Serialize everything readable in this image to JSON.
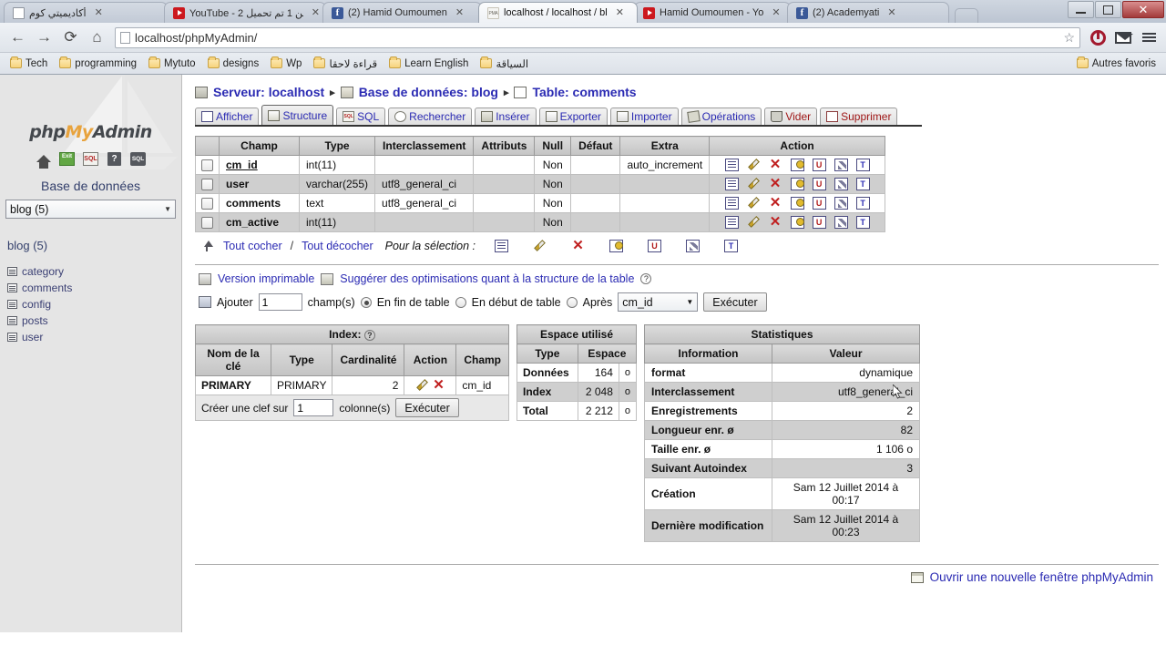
{
  "browser": {
    "tabs": [
      {
        "title": "أكاديميتي كوم",
        "favicon": "document-icon",
        "active": false,
        "width": 180
      },
      {
        "title": "YouTube - 2 من 1 تم تحميل",
        "favicon": "youtube-icon",
        "active": false,
        "width": 178
      },
      {
        "title": "(2) Hamid Oumoumen",
        "favicon": "facebook-icon",
        "active": false,
        "width": 175
      },
      {
        "title": "localhost / localhost / bl",
        "favicon": "phpmyadmin-icon",
        "active": true,
        "width": 175
      },
      {
        "title": "Hamid Oumoumen - Yo",
        "favicon": "youtube-icon",
        "active": false,
        "width": 172
      },
      {
        "title": "(2) Academyati",
        "favicon": "facebook-icon",
        "active": false,
        "width": 178
      }
    ],
    "tab_close_glyph": "✕",
    "nav": {
      "back": "←",
      "forward": "→",
      "reload": "⟳",
      "home": "⌂"
    },
    "url": "localhost/phpMyAdmin/",
    "url_host": "localhost",
    "url_path": "/phpMyAdmin/",
    "star_glyph": "☆",
    "window_controls": {
      "minimize": "",
      "maximize": "",
      "close": "✕"
    },
    "bookmarks": [
      "Tech",
      "programming",
      "Mytuto",
      "designs",
      "Wp",
      "قراءة لاحقا",
      "Learn English",
      "السياقة"
    ],
    "other_bookmarks": "Autres favoris"
  },
  "sidebar": {
    "logo": {
      "php": "php",
      "my": "My",
      "admin": "Admin"
    },
    "icons": [
      {
        "name": "home-icon",
        "label": ""
      },
      {
        "name": "exit-icon",
        "label": "Exit"
      },
      {
        "name": "sql-icon",
        "label": "SQL"
      },
      {
        "name": "help-icon",
        "label": "?"
      },
      {
        "name": "sql-bubble-icon",
        "label": "SQL"
      }
    ],
    "db_label": "Base de données",
    "db_select_value": "blog (5)",
    "db_current": "blog (5)",
    "tables": [
      "category",
      "comments",
      "config",
      "posts",
      "user"
    ]
  },
  "breadcrumb": {
    "server_label": "Serveur: localhost",
    "db_label": "Base de données: blog",
    "table_label": "Table: comments",
    "separator": "▸"
  },
  "tabs": [
    {
      "label": "Afficher",
      "icon": "view-icon",
      "active": false,
      "danger": false
    },
    {
      "label": "Structure",
      "icon": "structure-icon",
      "active": true,
      "danger": false
    },
    {
      "label": "SQL",
      "icon": "sql-icon",
      "active": false,
      "danger": false
    },
    {
      "label": "Rechercher",
      "icon": "search-icon",
      "active": false,
      "danger": false
    },
    {
      "label": "Insérer",
      "icon": "insert-icon",
      "active": false,
      "danger": false
    },
    {
      "label": "Exporter",
      "icon": "export-icon",
      "active": false,
      "danger": false
    },
    {
      "label": "Importer",
      "icon": "import-icon",
      "active": false,
      "danger": false
    },
    {
      "label": "Opérations",
      "icon": "operations-icon",
      "active": false,
      "danger": false
    },
    {
      "label": "Vider",
      "icon": "empty-icon",
      "active": false,
      "danger": true
    },
    {
      "label": "Supprimer",
      "icon": "drop-icon",
      "active": false,
      "danger": true
    }
  ],
  "structure": {
    "headers": [
      "",
      "Champ",
      "Type",
      "Interclassement",
      "Attributs",
      "Null",
      "Défaut",
      "Extra",
      "Action"
    ],
    "rows": [
      {
        "champ": "cm_id",
        "primary": true,
        "type": "int(11)",
        "interclassement": "",
        "attributs": "",
        "null": "Non",
        "defaut": "",
        "extra": "auto_increment"
      },
      {
        "champ": "user",
        "primary": false,
        "type": "varchar(255)",
        "interclassement": "utf8_general_ci",
        "attributs": "",
        "null": "Non",
        "defaut": "",
        "extra": ""
      },
      {
        "champ": "comments",
        "primary": false,
        "type": "text",
        "interclassement": "utf8_general_ci",
        "attributs": "",
        "null": "Non",
        "defaut": "",
        "extra": ""
      },
      {
        "champ": "cm_active",
        "primary": false,
        "type": "int(11)",
        "interclassement": "",
        "attributs": "",
        "null": "Non",
        "defaut": "",
        "extra": ""
      }
    ],
    "action_icons": [
      "browse-icon",
      "edit-icon",
      "delete-icon",
      "primary-key-icon",
      "unique-icon",
      "index-icon",
      "fulltext-icon"
    ]
  },
  "selection_bar": {
    "check_all": "Tout cocher",
    "separator": "/",
    "uncheck_all": "Tout décocher",
    "for_selection": "Pour la sélection :",
    "icons": [
      "browse-icon",
      "edit-icon",
      "delete-icon",
      "primary-key-icon",
      "unique-icon",
      "index-icon",
      "fulltext-icon"
    ]
  },
  "links": {
    "printable": "Version imprimable",
    "optimize": "Suggérer des optimisations quant à la structure de la table",
    "help_glyph": "?"
  },
  "add_field": {
    "label": "Ajouter",
    "count": "1",
    "unit": "champ(s)",
    "option_end": "En fin de table",
    "option_begin": "En début de table",
    "option_after": "Après",
    "after_value": "cm_id",
    "selected_option": "end",
    "execute": "Exécuter"
  },
  "index_panel": {
    "title": "Index:",
    "help_glyph": "?",
    "headers": [
      "Nom de la clé",
      "Type",
      "Cardinalité",
      "Action",
      "Champ"
    ],
    "rows": [
      {
        "nom": "PRIMARY",
        "type": "PRIMARY",
        "cardinalite": "2",
        "champ": "cm_id"
      }
    ],
    "create_key_prefix": "Créer une clef sur",
    "create_key_count": "1",
    "create_key_suffix": "colonne(s)",
    "execute": "Exécuter"
  },
  "space_panel": {
    "title": "Espace utilisé",
    "headers": [
      "Type",
      "Espace"
    ],
    "rows": [
      {
        "type": "Données",
        "espace": "164",
        "unit": "o"
      },
      {
        "type": "Index",
        "espace": "2 048",
        "unit": "o"
      },
      {
        "type": "Total",
        "espace": "2 212",
        "unit": "o"
      }
    ]
  },
  "stats_panel": {
    "title": "Statistiques",
    "headers": [
      "Information",
      "Valeur"
    ],
    "rows": [
      {
        "info": "format",
        "valeur": "dynamique",
        "date": false
      },
      {
        "info": "Interclassement",
        "valeur": "utf8_general_ci",
        "date": false
      },
      {
        "info": "Enregistrements",
        "valeur": "2",
        "date": false
      },
      {
        "info": "Longueur enr. ø",
        "valeur": "82",
        "date": false
      },
      {
        "info": "Taille enr. ø",
        "valeur": "1 106 o",
        "date": false
      },
      {
        "info": "Suivant Autoindex",
        "valeur": "3",
        "date": false
      },
      {
        "info": "Création",
        "valeur": "Sam 12 Juillet 2014 à 00:17",
        "date": true
      },
      {
        "info": "Dernière modification",
        "valeur": "Sam 12 Juillet 2014 à 00:23",
        "date": true
      }
    ]
  },
  "footer": {
    "new_window": "Ouvrir une nouvelle fenêtre phpMyAdmin"
  },
  "colors": {
    "link": "#2b2bb3",
    "danger": "#a01818",
    "header_bg": "#cdcdcd",
    "row_even": "#cfcfcf",
    "row_odd": "#ffffff",
    "accent_orange": "#e8a33d"
  }
}
